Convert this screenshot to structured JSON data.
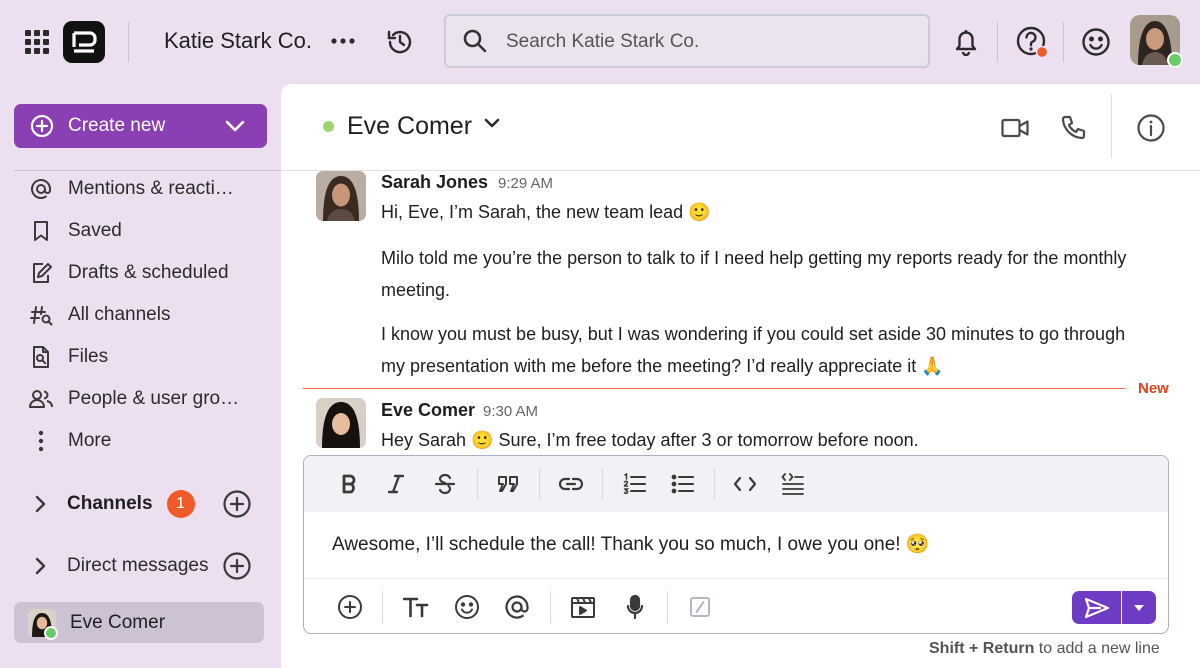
{
  "topbar": {
    "org_name": "Katie Stark Co.",
    "search_placeholder": "Search Katie Stark Co."
  },
  "sidebar": {
    "create_label": "Create new",
    "items": [
      {
        "label": "Mentions & reacti…",
        "icon": "at-icon"
      },
      {
        "label": "Saved",
        "icon": "bookmark-icon"
      },
      {
        "label": "Drafts & scheduled",
        "icon": "drafts-icon"
      },
      {
        "label": "All channels",
        "icon": "channel-search-icon"
      },
      {
        "label": "Files",
        "icon": "file-search-icon"
      },
      {
        "label": "People & user gro…",
        "icon": "people-icon"
      },
      {
        "label": "More",
        "icon": "more-vertical-icon"
      }
    ],
    "channels_label": "Channels",
    "channels_badge": "1",
    "dm_label": "Direct messages",
    "active_dm": "Eve Comer"
  },
  "channel": {
    "title": "Eve Comer",
    "presence_color": "#9fd36e"
  },
  "messages": [
    {
      "sender": "Sarah Jones",
      "time": "9:29 AM",
      "lines": [
        "Hi, Eve, I’m Sarah, the new team lead 🙂",
        "Milo told me you’re the person to talk to if I need help getting my reports ready for the monthly meeting.",
        "I know you must be busy, but I was wondering if you could set aside 30 minutes to go through my presentation with me before the meeting? I’d really appreciate it 🙏"
      ]
    },
    {
      "sender": "Eve Comer",
      "time": "9:30 AM",
      "lines": [
        "Hey Sarah 🙂 Sure, I’m free today after 3 or tomorrow before noon."
      ]
    }
  ],
  "new_marker": "New",
  "composer": {
    "text": "Awesome, I’ll schedule the call! Thank you so much, I owe you one! 🥺",
    "hint_key": "Shift + Return",
    "hint_rest": " to add a new line"
  },
  "colors": {
    "background": "#ecdff0",
    "accent": "#8a3fb3",
    "send": "#6e3cc4",
    "badge": "#f05a28",
    "new_marker": "#e0451f"
  }
}
